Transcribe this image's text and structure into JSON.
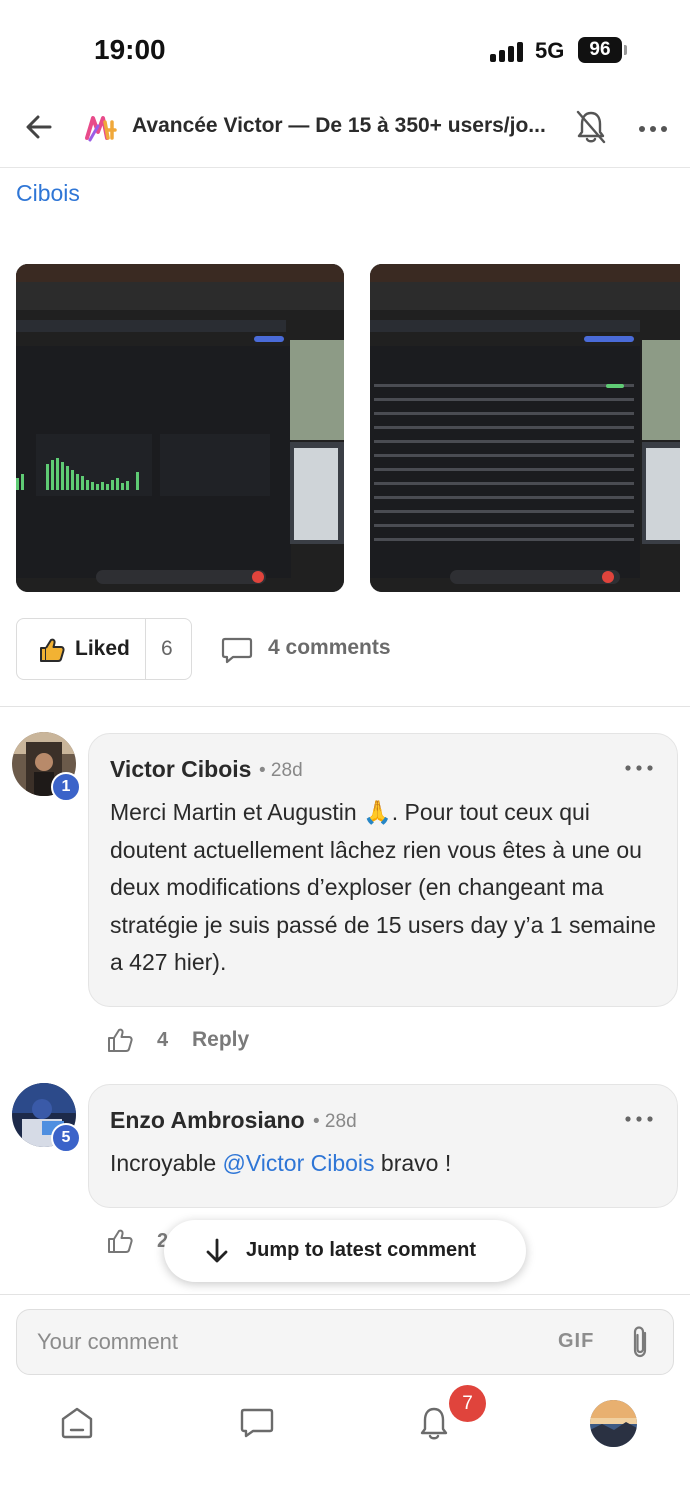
{
  "status_bar": {
    "time": "19:00",
    "network": "5G",
    "battery": "96"
  },
  "header": {
    "title": "Avancée Victor — De 15 à 350+ users/jo..."
  },
  "post": {
    "author_tail": "Cibois",
    "liked_label": "Liked",
    "like_count": "6",
    "comments_label": "4 comments"
  },
  "comments": [
    {
      "author": "Victor Cibois",
      "time": "• 28d",
      "badge": "1",
      "text": "Merci Martin et Augustin 🙏. Pour tout ceux qui doutent actuellement lâchez rien vous êtes à une ou deux modifications d’exploser (en changeant ma stratégie je suis passé de 15 users day y’a 1 semaine a 427 hier).",
      "likes": "4",
      "reply": "Reply"
    },
    {
      "author": "Enzo Ambrosiano",
      "time": "• 28d",
      "badge": "5",
      "text_before": "Incroyable ",
      "mention": "@Victor Cibois",
      "text_after": " bravo !",
      "likes": "2"
    }
  ],
  "jump_button": "Jump to latest comment",
  "composer": {
    "placeholder": "Your comment",
    "gif": "GIF"
  },
  "bottom_nav": {
    "notification_count": "7"
  },
  "colors": {
    "link": "#2f76d6",
    "badge": "#3b63c9",
    "notification": "#e0443c",
    "bubble": "#f4f4f4"
  }
}
